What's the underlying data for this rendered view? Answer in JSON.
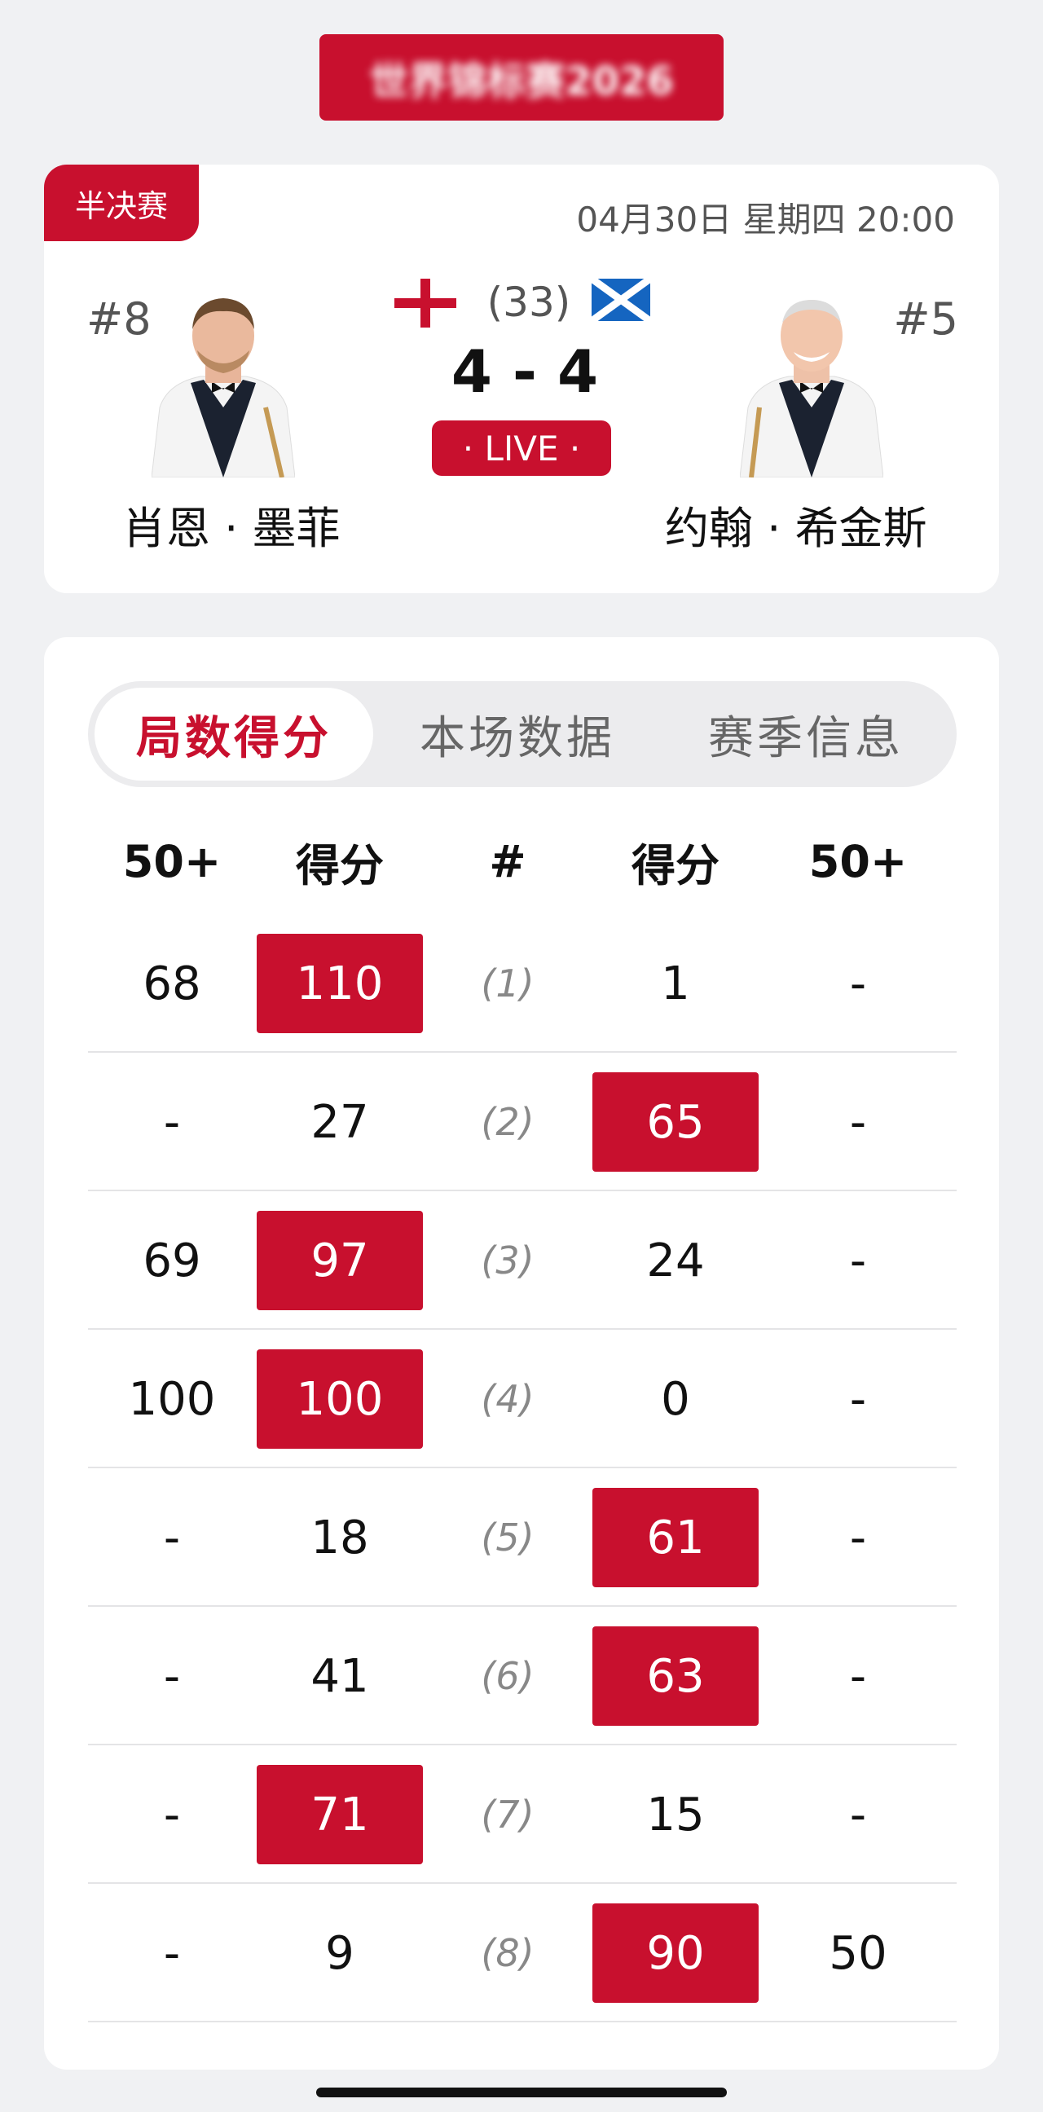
{
  "banner": {
    "title": "世界锦标赛2026"
  },
  "match": {
    "stage": "半决赛",
    "datetime": "04月30日 星期四 20:00",
    "best_of": "(33)",
    "score": "4 - 4",
    "status": "· LIVE ·",
    "player_left": {
      "seed": "#8",
      "name": "肖恩 · 墨菲",
      "flag": "england-flag-icon"
    },
    "player_right": {
      "seed": "#5",
      "name": "约翰 · 希金斯",
      "flag": "scotland-flag-icon"
    }
  },
  "tabs": [
    "局数得分",
    "本场数据",
    "赛季信息"
  ],
  "table": {
    "headers": [
      "50+",
      "得分",
      "#",
      "得分",
      "50+"
    ],
    "rows": [
      {
        "left_break": "68",
        "left_score": "110",
        "frame": "(1)",
        "right_score": "1",
        "right_break": "-",
        "winner": "left"
      },
      {
        "left_break": "-",
        "left_score": "27",
        "frame": "(2)",
        "right_score": "65",
        "right_break": "-",
        "winner": "right"
      },
      {
        "left_break": "69",
        "left_score": "97",
        "frame": "(3)",
        "right_score": "24",
        "right_break": "-",
        "winner": "left"
      },
      {
        "left_break": "100",
        "left_score": "100",
        "frame": "(4)",
        "right_score": "0",
        "right_break": "-",
        "winner": "left"
      },
      {
        "left_break": "-",
        "left_score": "18",
        "frame": "(5)",
        "right_score": "61",
        "right_break": "-",
        "winner": "right"
      },
      {
        "left_break": "-",
        "left_score": "41",
        "frame": "(6)",
        "right_score": "63",
        "right_break": "-",
        "winner": "right"
      },
      {
        "left_break": "-",
        "left_score": "71",
        "frame": "(7)",
        "right_score": "15",
        "right_break": "-",
        "winner": "left"
      },
      {
        "left_break": "-",
        "left_score": "9",
        "frame": "(8)",
        "right_score": "90",
        "right_break": "50",
        "winner": "right"
      }
    ]
  },
  "colors": {
    "accent": "#c8102e",
    "background": "#f0f1f3"
  }
}
